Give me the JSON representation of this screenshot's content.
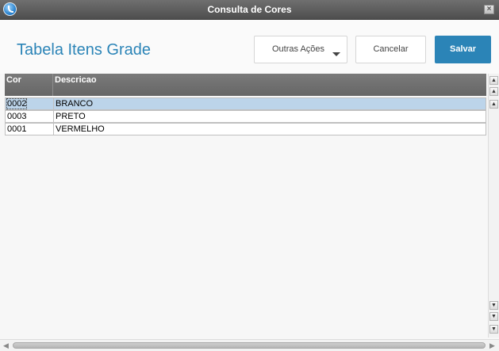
{
  "window": {
    "title": "Consulta de Cores",
    "close_symbol": "×"
  },
  "header": {
    "page_title": "Tabela Itens Grade",
    "buttons": {
      "outras_acoes": "Outras Ações",
      "cancelar": "Cancelar",
      "salvar": "Salvar"
    }
  },
  "grid": {
    "columns": [
      "Cor",
      "Descricao"
    ],
    "rows": [
      {
        "cor": "0002",
        "descricao": "BRANCO",
        "selected": true
      },
      {
        "cor": "0003",
        "descricao": "PRETO",
        "selected": false
      },
      {
        "cor": "0001",
        "descricao": "VERMELHO",
        "selected": false
      }
    ]
  },
  "colors": {
    "accent": "#2b84b7",
    "selected_row": "#bcd4ea",
    "header_bg": "#6e6e6e"
  },
  "icons": [
    "app-logo-icon",
    "close-icon",
    "dropdown-caret-icon",
    "scroll-top-icon",
    "page-up-icon",
    "scroll-up-icon",
    "scroll-down-icon",
    "page-down-icon",
    "scroll-bottom-icon",
    "scroll-left-icon",
    "scroll-right-icon"
  ]
}
